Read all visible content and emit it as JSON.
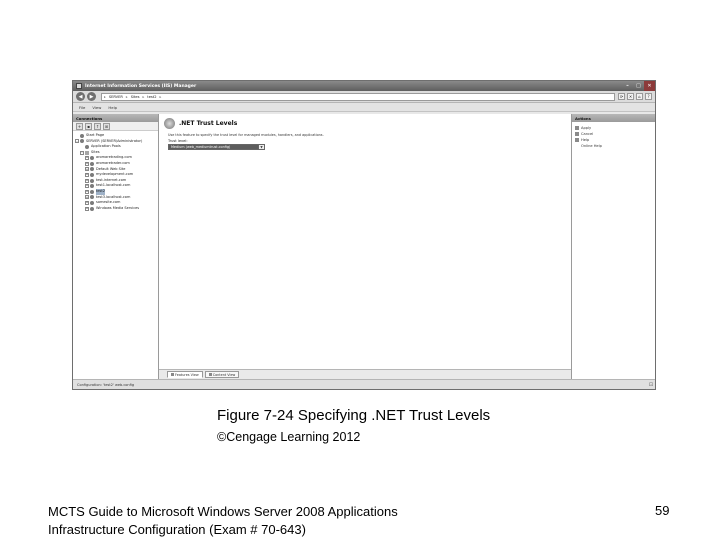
{
  "window": {
    "title": "Internet Information Services (IIS) Manager",
    "controls": {
      "minimize": "–",
      "maximize": "□",
      "close": "✕"
    }
  },
  "address": {
    "crumbs": [
      "SERVER",
      "Sites",
      "test2"
    ],
    "separator": "▸"
  },
  "menu": [
    "File",
    "View",
    "Help"
  ],
  "connections": {
    "header": "Connections",
    "tree": [
      {
        "label": "Start Page",
        "icon": "start-page-icon",
        "depth": 0,
        "expander": ""
      },
      {
        "label": "SERVER (SERVER\\Administrator)",
        "icon": "server-icon",
        "depth": 0,
        "expander": "–"
      },
      {
        "label": "Application Pools",
        "icon": "app-pools-icon",
        "depth": 1,
        "expander": ""
      },
      {
        "label": "Sites",
        "icon": "folder-icon",
        "depth": 1,
        "expander": "–"
      },
      {
        "label": "aromaretrading.com",
        "icon": "globe-icon",
        "depth": 2,
        "expander": "+"
      },
      {
        "label": "aromaretrader.com",
        "icon": "globe-icon",
        "depth": 2,
        "expander": "+"
      },
      {
        "label": "Default Web Site",
        "icon": "globe-icon",
        "depth": 2,
        "expander": "+"
      },
      {
        "label": "mydevelopment.com",
        "icon": "globe-icon",
        "depth": 2,
        "expander": "+"
      },
      {
        "label": "test.internet.com",
        "icon": "globe-icon",
        "depth": 2,
        "expander": "+"
      },
      {
        "label": "test1.localhost.com",
        "icon": "globe-icon",
        "depth": 2,
        "expander": "+"
      },
      {
        "label": "test2",
        "icon": "globe-icon",
        "depth": 2,
        "expander": "+",
        "selected": true
      },
      {
        "label": "test3.localhost.com",
        "icon": "globe-icon",
        "depth": 2,
        "expander": "+"
      },
      {
        "label": "somesite.com",
        "icon": "globe-icon",
        "depth": 2,
        "expander": "+"
      },
      {
        "label": "Windows Media Services",
        "icon": "globe-icon",
        "depth": 2,
        "expander": "+"
      }
    ]
  },
  "feature": {
    "title": ".NET Trust Levels",
    "description": "Use this feature to specify the trust level for managed modules, handlers, and applications.",
    "trust_label": "Trust level:",
    "trust_value": "Medium (web_mediumtrust.config)",
    "dropdown_arrow": "▼"
  },
  "view_tabs": {
    "features": "Features View",
    "content": "Content View"
  },
  "actions": {
    "header": "Actions",
    "items": [
      {
        "label": "Apply",
        "icon": "apply-icon",
        "sub": false
      },
      {
        "label": "Cancel",
        "icon": "cancel-icon",
        "sub": false
      },
      {
        "label": "Help",
        "icon": "help-icon",
        "sub": false
      },
      {
        "label": "Online Help",
        "icon": "",
        "sub": true
      }
    ]
  },
  "status": {
    "text": "Configuration: 'test2' web.config"
  },
  "slide": {
    "caption": "Figure 7-24 Specifying .NET Trust Levels",
    "copyright": "©Cengage Learning 2012",
    "footer_line1": "MCTS Guide to Microsoft Windows Server 2008 Applications",
    "footer_line2": "Infrastructure Configuration (Exam # 70-643)",
    "page_number": "59"
  }
}
